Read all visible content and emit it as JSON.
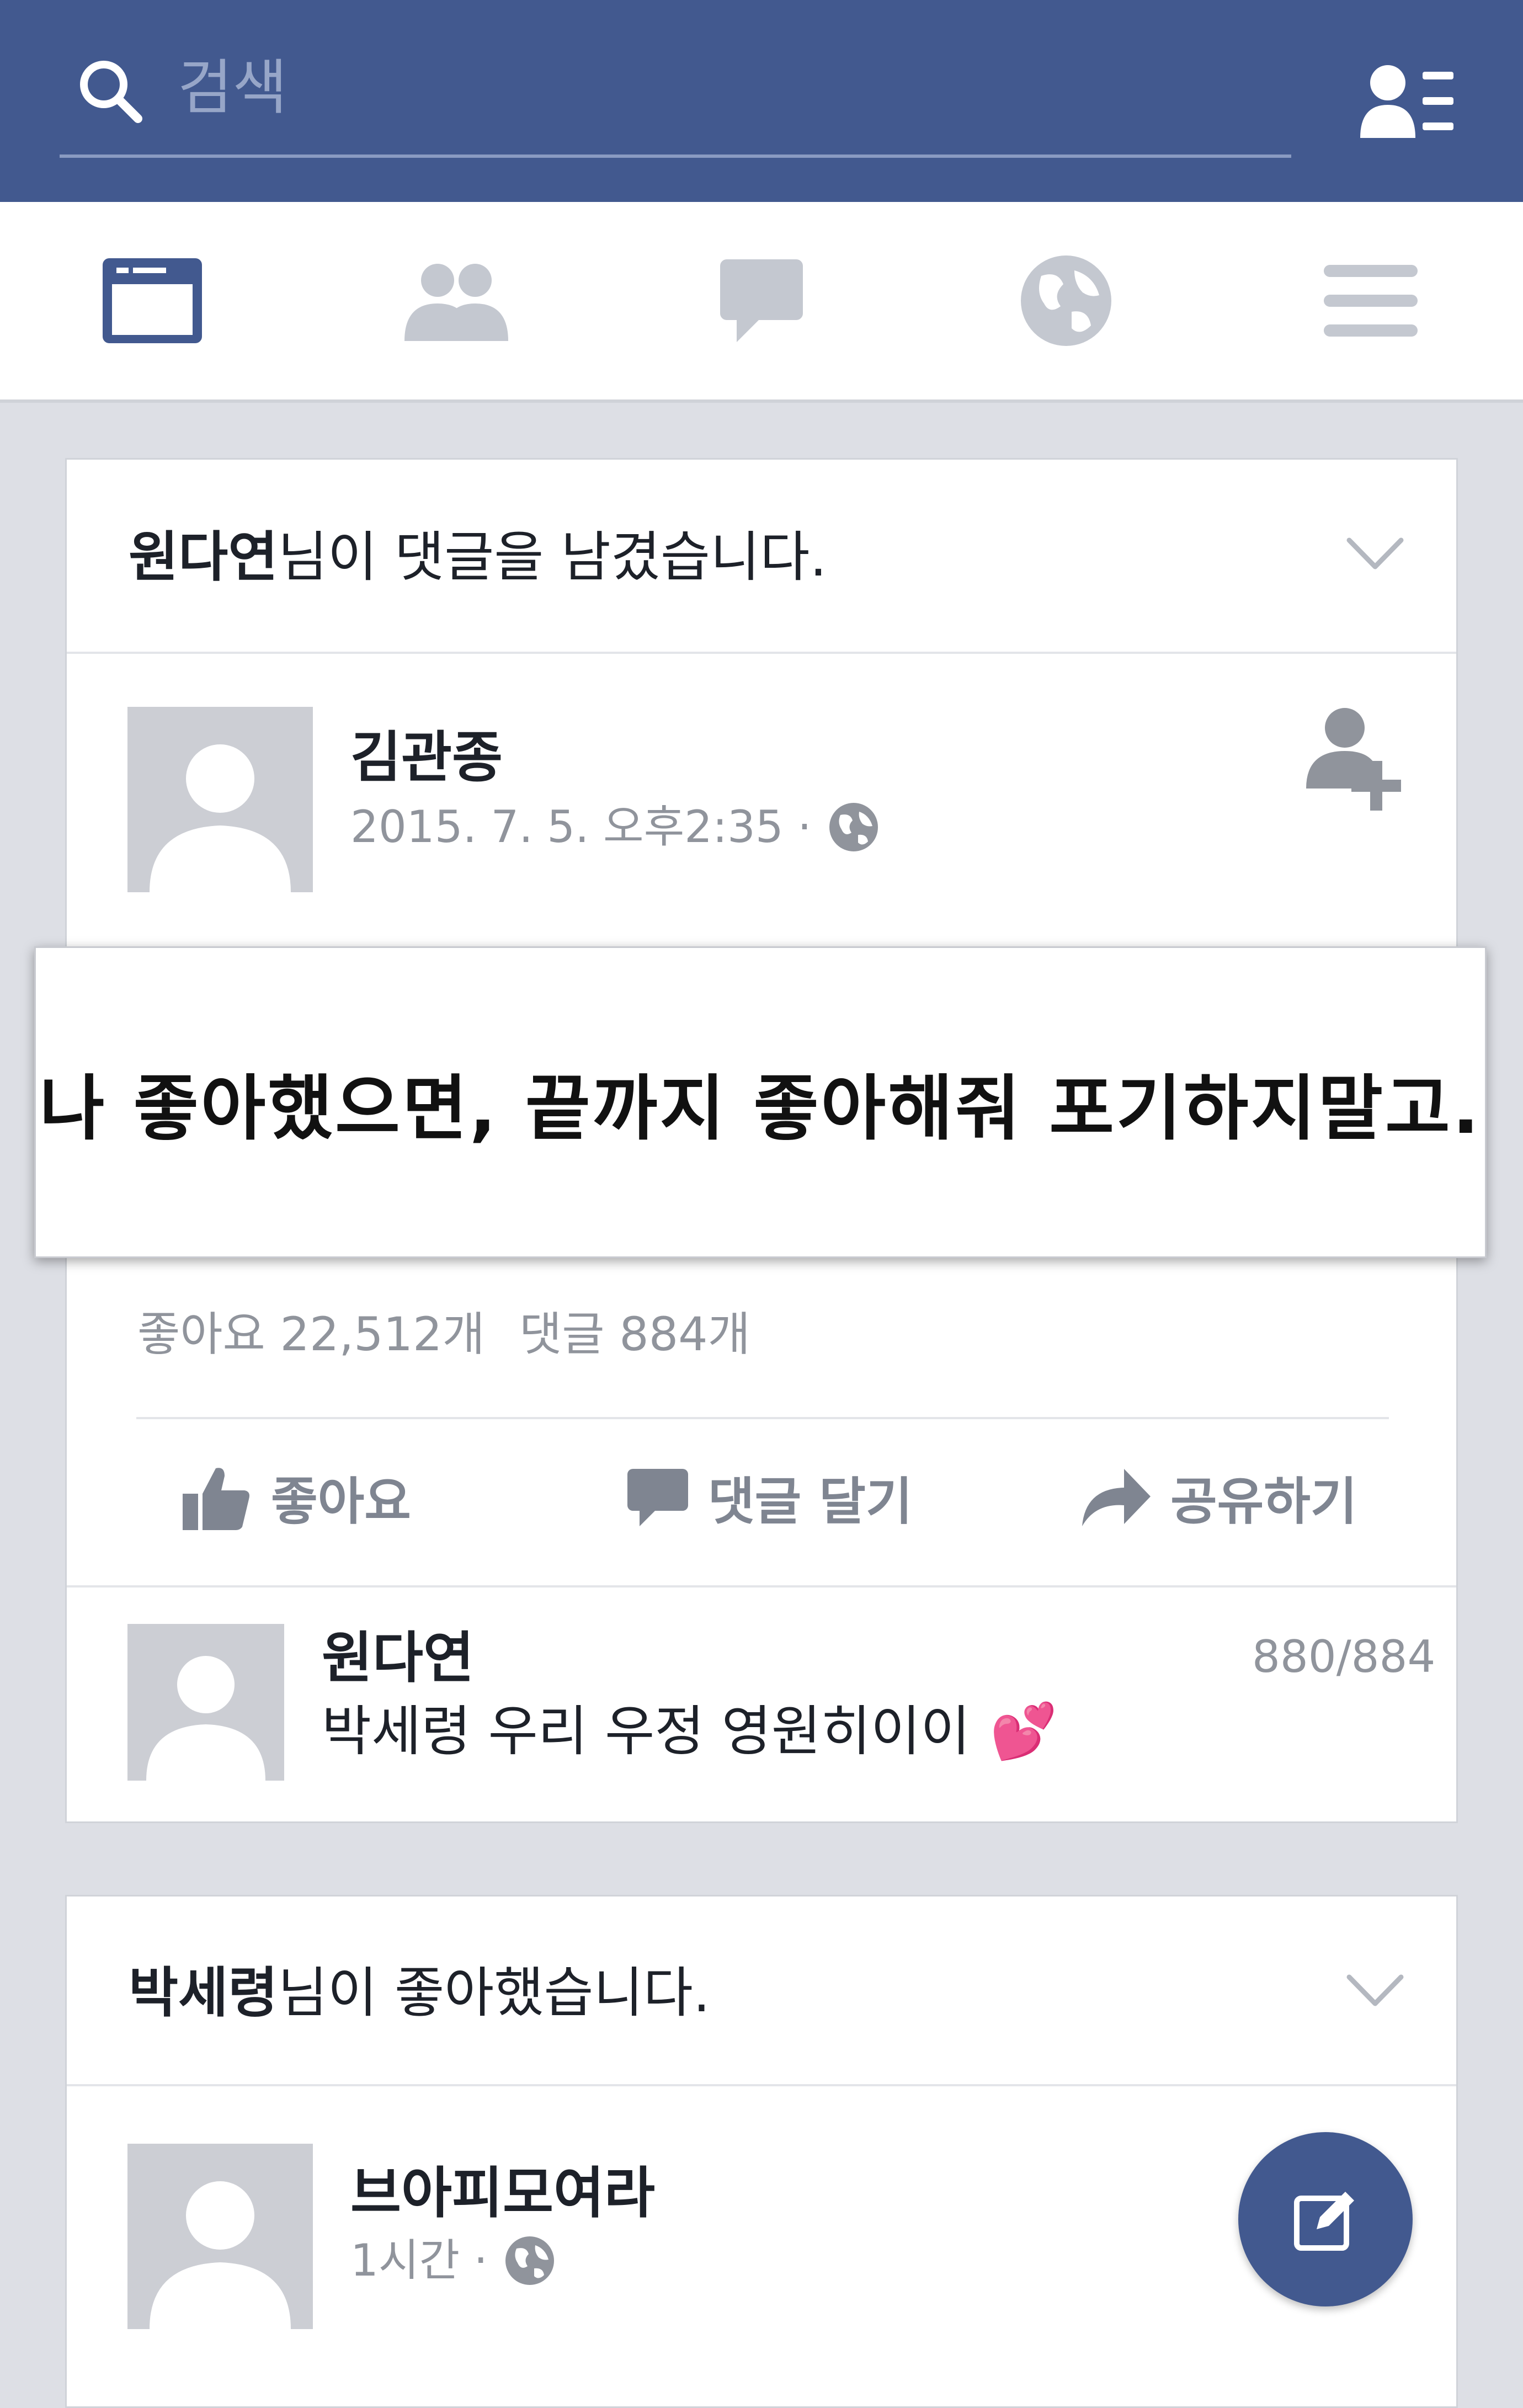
{
  "search": {
    "placeholder": "검색"
  },
  "tabs": [
    {
      "icon": "news-feed-icon",
      "active": true
    },
    {
      "icon": "friends-icon",
      "active": false
    },
    {
      "icon": "messages-icon",
      "active": false
    },
    {
      "icon": "globe-icon",
      "active": false
    },
    {
      "icon": "menu-icon",
      "active": false
    }
  ],
  "story1": {
    "actor": "원다연",
    "action_text": "님이 댓글을 남겼습니다.",
    "post": {
      "author": "김관종",
      "timestamp": "2015. 7. 5. 오후2:35 ·",
      "quote": "나 좋아했으면, 끝까지 좋아해줘 포기하지말고.",
      "likes": "좋아요 22,512개",
      "comments": "댓글 884개"
    },
    "actions": {
      "like": "좋아요",
      "comment": "댓글 달기",
      "share": "공유하기"
    },
    "comment": {
      "author": "원다연",
      "text": "박세령 우리 우정 영원히이이",
      "emoji": "💕",
      "position": "880/884"
    }
  },
  "story2": {
    "actor": "박세령",
    "action_text": "님이 좋아했습니다.",
    "post": {
      "author": "브아피모여라",
      "timestamp": "1시간 ·"
    }
  },
  "colors": {
    "brand": "#42598f",
    "muted": "#90949c",
    "background": "#dddfe5"
  }
}
